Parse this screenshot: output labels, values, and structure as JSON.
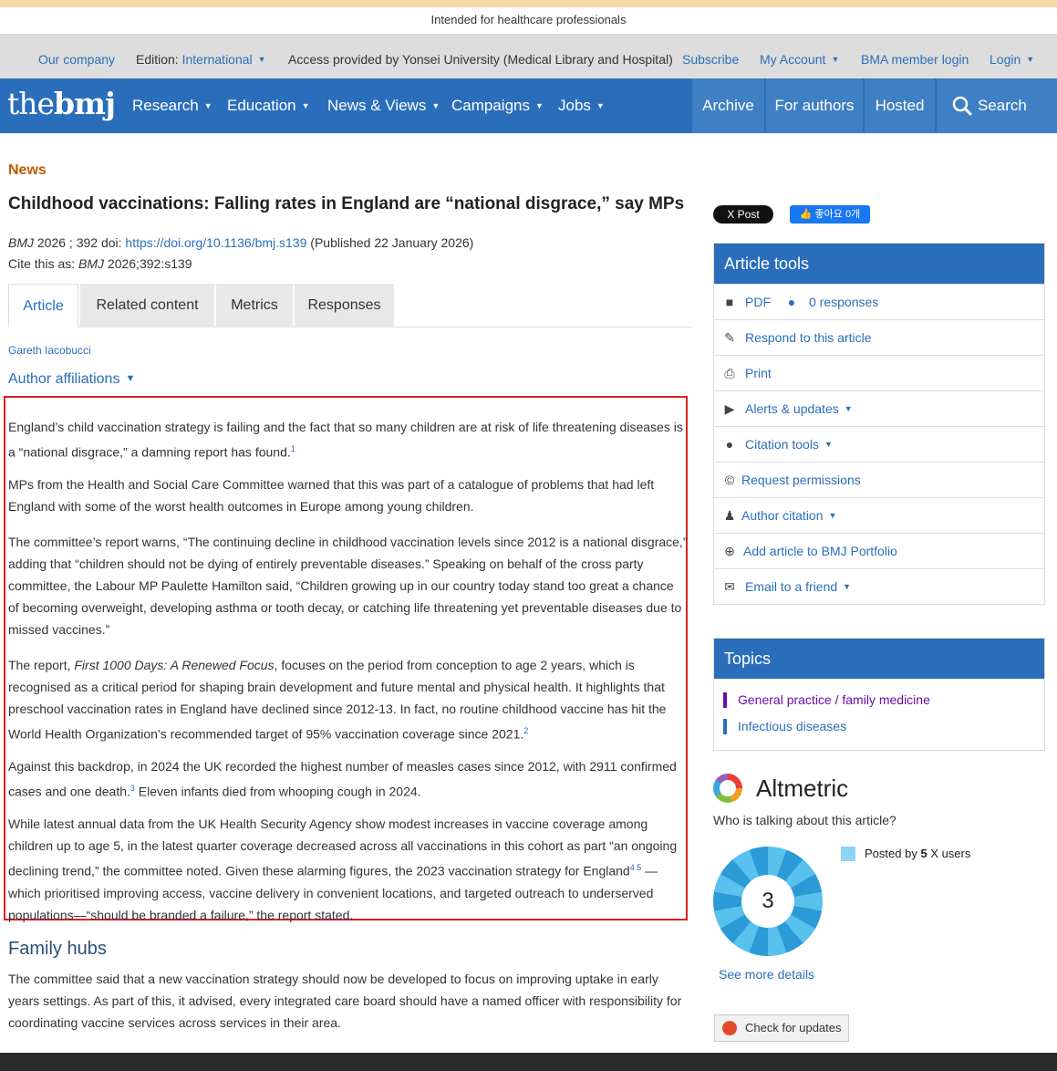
{
  "hcp_banner": "Intended for healthcare professionals",
  "utility": {
    "our_company": "Our company",
    "edition_label": "Edition:",
    "edition_value": "International",
    "access": "Access provided by Yonsei University (Medical Library and Hospital)",
    "subscribe": "Subscribe",
    "my_account": "My Account",
    "bma_login": "BMA member login",
    "login": "Login"
  },
  "nav": {
    "logo_the": "the",
    "logo_bmj": "bmj",
    "research": "Research",
    "education": "Education",
    "news_views": "News & Views",
    "campaigns": "Campaigns",
    "jobs": "Jobs",
    "archive": "Archive",
    "for_authors": "For authors",
    "hosted": "Hosted",
    "search": "Search"
  },
  "article": {
    "section": "News",
    "title": "Childhood vaccinations: Falling rates in England are “national disgrace,” say MPs",
    "journal": "BMJ",
    "year_vol": " 2026 ; 392  doi: ",
    "doi": "https://doi.org/10.1136/bmj.s139",
    "published": " (Published 22 January 2026)",
    "cite_label": "Cite this as: ",
    "cite_journal": "BMJ",
    "cite_ref": " 2026;392:s139",
    "author": "Gareth Iacobucci",
    "affiliations": "Author affiliations",
    "tabs": [
      "Article",
      "Related content",
      "Metrics",
      "Responses"
    ],
    "p1": "England’s child vaccination strategy is failing and the fact that so many children are at risk of life threatening diseases is a “national disgrace,” a damning report has found.",
    "p1_ref": "1",
    "p2": "MPs from the Health and Social Care Committee warned that this was part of a catalogue of problems that had left England with some of the worst health outcomes in Europe among young children.",
    "p3": "The committee’s report warns, “The continuing decline in childhood vaccination levels since 2012 is a national disgrace,” adding that “children should not be dying of entirely preventable diseases.” Speaking on behalf of the cross party committee, the Labour MP Paulette Hamilton said, “Children growing up in our country today stand too great a chance of becoming overweight, developing asthma or tooth decay, or catching life threatening yet preventable diseases due to missed vaccines.”",
    "p4_pre": "The report, ",
    "p4_em": "First 1000 Days: A Renewed Focus",
    "p4_post": ", focuses on the period from conception to age 2 years, which is recognised as a critical period for shaping brain development and future mental and physical health. It highlights that preschool vaccination rates in England have declined since 2012-13. In fact, no routine childhood vaccine has hit the World Health Organization’s recommended target of 95% vaccination coverage since 2021.",
    "p4_ref": "2",
    "p5_pre": "Against this backdrop, in 2024 the UK recorded the highest number of measles cases since 2012, with 2911 confirmed cases and one death.",
    "p5_ref": "3",
    "p5_post": "  Eleven infants died from whooping cough in 2024.",
    "p6_pre": "While latest annual data from the UK Health Security Agency show modest increases in vaccine coverage among children up to age 5, in the latest quarter coverage decreased across all vaccinations in this cohort as part “an ongoing declining trend,” the committee noted. Given these alarming figures, the 2023 vaccination strategy for England",
    "p6_ref": "4 5",
    "p6_post": " —which prioritised improving access, vaccine delivery in convenient locations, and targeted outreach to underserved populations—“should be branded a failure,” the report stated.",
    "h2": "Family hubs",
    "p7": "The committee said that a new vaccination strategy should now be developed to focus on improving uptake in early years settings. As part of this, it advised, every integrated care board should have a named officer with responsibility for coordinating vaccine services across services in their area."
  },
  "social": {
    "x_post": "X Post",
    "fb_like": "👍 좋아요 0개"
  },
  "tools": {
    "heading": "Article tools",
    "pdf": "PDF",
    "responses": "0 responses",
    "respond": "Respond to this article",
    "print": "Print",
    "alerts": "Alerts & updates",
    "citation": "Citation tools",
    "permissions": "Request permissions",
    "author_citation": "Author citation",
    "portfolio": "Add article to BMJ Portfolio",
    "email": "Email to a friend"
  },
  "topics": {
    "heading": "Topics",
    "items": [
      {
        "label": "General practice / family medicine",
        "color": "#6a0dad"
      },
      {
        "label": "Infectious diseases",
        "color": "#2a6ebb"
      }
    ]
  },
  "altmetric": {
    "name": "Altmetric",
    "question": "Who is talking about this article?",
    "score": "3",
    "posted_pre": "Posted by ",
    "posted_count": "5",
    "posted_post": " X users",
    "more": "See more details"
  },
  "check_updates": "Check for updates"
}
